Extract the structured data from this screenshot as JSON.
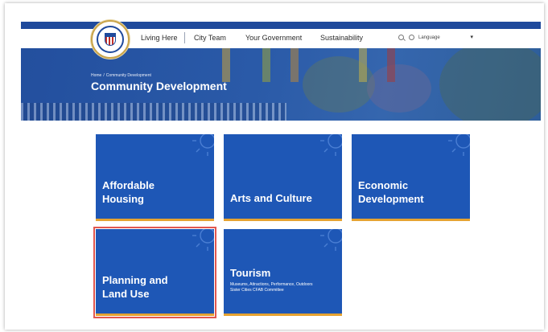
{
  "nav": {
    "items": [
      "Living Here",
      "City Team",
      "Your Government",
      "Sustainability"
    ],
    "language_label": "Language"
  },
  "hero": {
    "breadcrumb": [
      "Home",
      "Community Development"
    ],
    "title": "Community Development"
  },
  "cards": [
    {
      "title_lines": [
        "Affordable",
        "Housing"
      ],
      "subtitle": []
    },
    {
      "title_lines": [
        "Arts and Culture"
      ],
      "subtitle": []
    },
    {
      "title_lines": [
        "Economic",
        "Development"
      ],
      "subtitle": []
    },
    {
      "title_lines": [
        "Planning and",
        "Land Use"
      ],
      "subtitle": []
    },
    {
      "title_lines": [
        "Tourism"
      ],
      "subtitle": [
        "Museums, Attractions, Performance, Outdoors",
        "Sister Cities CFAB Committee"
      ]
    }
  ],
  "colors": {
    "brand_blue": "#1f4a9c",
    "card_blue": "#1e57b6",
    "card_accent": "#e6a331",
    "selection_outline": "#e2574f"
  },
  "icons": [
    "search-icon",
    "globe-icon",
    "chevron-down-icon",
    "sun-icon"
  ]
}
